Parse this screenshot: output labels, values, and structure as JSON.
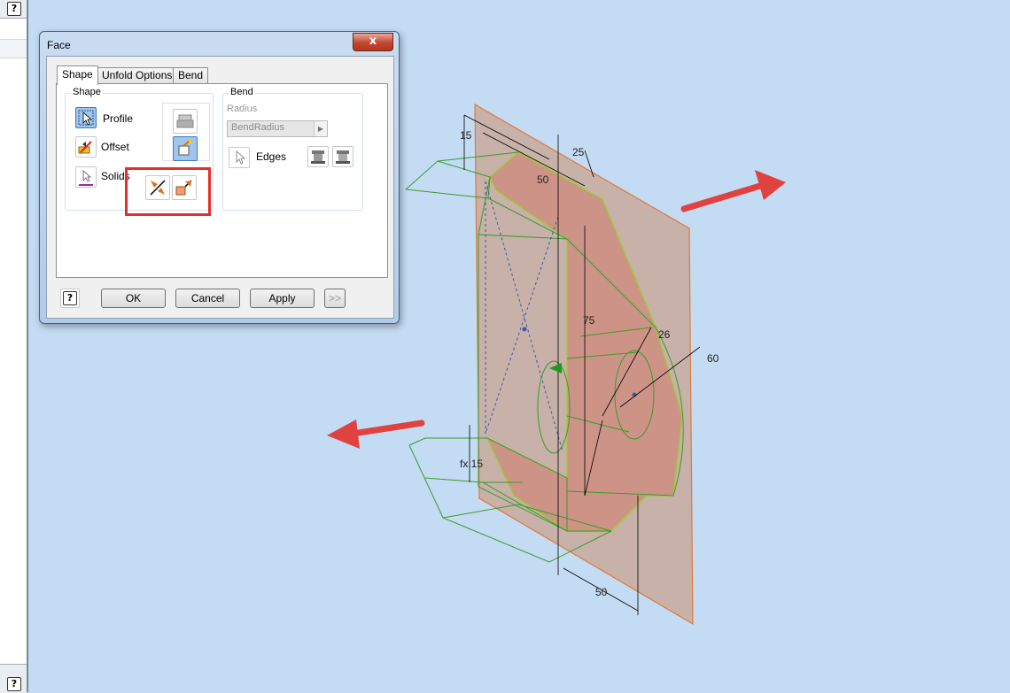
{
  "dialog": {
    "title": "Face",
    "close_label": "x",
    "tabs": [
      "Shape",
      "Unfold Options",
      "Bend"
    ],
    "shape_group": {
      "title": "Shape",
      "profile_label": "Profile",
      "offset_label": "Offset",
      "solids_label": "Solids"
    },
    "bend_group": {
      "title": "Bend",
      "radius_label": "Radius",
      "radius_value": "BendRadius",
      "edges_label": "Edges"
    },
    "buttons": {
      "help": "?",
      "ok": "OK",
      "cancel": "Cancel",
      "apply": "Apply",
      "more": ">>"
    }
  },
  "dimensions": {
    "d15_top": "15",
    "d25": "25",
    "d50_top": "50",
    "d75": "75",
    "d26": "26",
    "d60": "60",
    "d15_fx": "fx:15",
    "d50_bottom": "50"
  },
  "left_panel": {
    "help_top": "?",
    "help_bottom": "?"
  },
  "colors": {
    "viewport_bg": "#c3dbf3",
    "highlight": "#e3302b",
    "arrow": "#e0433f",
    "sketch": "#3c9a2e",
    "sheet": "#c8a99a"
  }
}
